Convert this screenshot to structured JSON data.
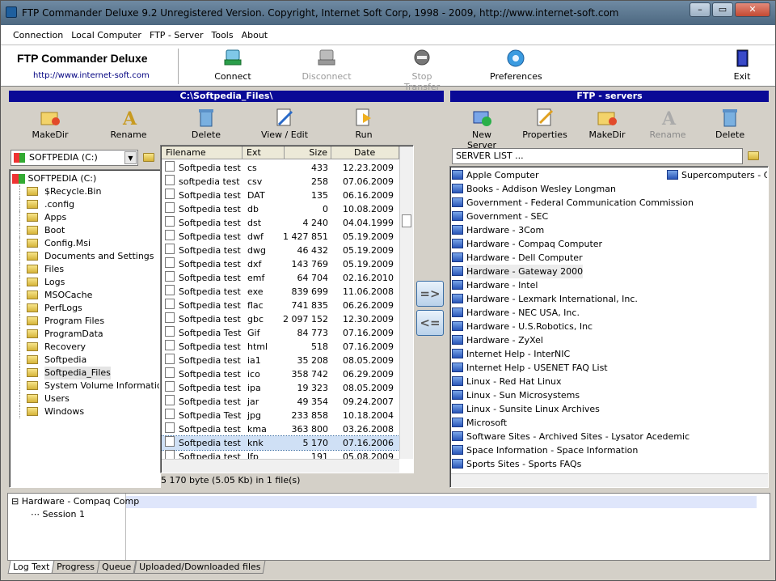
{
  "window": {
    "title": "FTP Commander Deluxe 9.2  Unregistered Version. Copyright, Internet Soft Corp, 1998 - 2009, http://www.internet-soft.com",
    "min": "–",
    "max": "▭",
    "close": "✕"
  },
  "menu": [
    "Connection",
    "Local Computer",
    "FTP - Server",
    "Tools",
    "About"
  ],
  "brand": {
    "name": "FTP Commander Deluxe",
    "url": "http://www.internet-soft.com"
  },
  "toolbar": {
    "connect": "Connect",
    "disconnect": "Disconnect",
    "stop": "Stop Transfer",
    "prefs": "Preferences",
    "exit": "Exit"
  },
  "left": {
    "path": "C:\\Softpedia_Files\\",
    "makedir": "MakeDir",
    "rename": "Rename",
    "delete": "Delete",
    "view": "View / Edit",
    "run": "Run",
    "drive": "SOFTPEDIA (C:)"
  },
  "tree": {
    "root": "SOFTPEDIA (C:)",
    "items": [
      "$Recycle.Bin",
      ".config",
      "Apps",
      "Boot",
      "Config.Msi",
      "Documents and Settings",
      "Files",
      "Logs",
      "MSOCache",
      "PerfLogs",
      "Program Files",
      "ProgramData",
      "Recovery",
      "Softpedia",
      "Softpedia_Files",
      "System Volume Information",
      "Users",
      "Windows"
    ]
  },
  "files": {
    "headers": [
      "Filename",
      "Ext",
      "Size",
      "Date"
    ],
    "rows": [
      [
        "Softpedia test",
        "cs",
        "433",
        "12.23.2009"
      ],
      [
        "softpedia test",
        "csv",
        "258",
        "07.06.2009"
      ],
      [
        "Softpedia test",
        "DAT",
        "135",
        "06.16.2009"
      ],
      [
        "Softpedia test",
        "db",
        "0",
        "10.08.2009"
      ],
      [
        "Softpedia test",
        "dst",
        "4 240",
        "04.04.1999"
      ],
      [
        "Softpedia test",
        "dwf",
        "1 427 851",
        "05.19.2009"
      ],
      [
        "Softpedia test",
        "dwg",
        "46 432",
        "05.19.2009"
      ],
      [
        "Softpedia test",
        "dxf",
        "143 769",
        "05.19.2009"
      ],
      [
        "Softpedia test",
        "emf",
        "64 704",
        "02.16.2010"
      ],
      [
        "Softpedia test",
        "exe",
        "839 699",
        "11.06.2008"
      ],
      [
        "Softpedia test",
        "flac",
        "741 835",
        "06.26.2009"
      ],
      [
        "Softpedia test",
        "gbc",
        "2 097 152",
        "12.30.2009"
      ],
      [
        "Softpedia Test",
        "Gif",
        "84 773",
        "07.16.2009"
      ],
      [
        "Softpedia test",
        "html",
        "518",
        "07.16.2009"
      ],
      [
        "Softpedia test",
        "ia1",
        "35 208",
        "08.05.2009"
      ],
      [
        "Softpedia test",
        "ico",
        "358 742",
        "06.29.2009"
      ],
      [
        "Softpedia test",
        "ipa",
        "19 323",
        "08.05.2009"
      ],
      [
        "Softpedia test",
        "jar",
        "49 354",
        "09.24.2007"
      ],
      [
        "Softpedia Test",
        "jpg",
        "233 858",
        "10.18.2004"
      ],
      [
        "Softpedia test",
        "kma",
        "363 800",
        "03.26.2008"
      ],
      [
        "Softpedia test",
        "knk",
        "5 170",
        "07.16.2006"
      ],
      [
        "Softpedia test",
        "lfp",
        "191",
        "05.08.2009"
      ]
    ]
  },
  "status": "5 170 byte (5.05 Kb) in 1 file(s)",
  "transfer": {
    "right": "=>",
    "left": "<="
  },
  "right": {
    "header": "FTP - servers",
    "new": "New Server",
    "props": "Properties",
    "makedir": "MakeDir",
    "rename": "Rename",
    "delete": "Delete",
    "combo": "SERVER LIST ..."
  },
  "servers": [
    "Apple Computer",
    "Books - Addison Wesley Longman",
    "Government - Federal Communication Commission",
    "Government - SEC",
    "Hardware - 3Com",
    "Hardware - Compaq Computer",
    "Hardware - Dell Computer",
    "Hardware - Gateway 2000",
    "Hardware - Intel",
    "Hardware - Lexmark International, Inc.",
    "Hardware - NEC USA, Inc.",
    "Hardware - U.S.Robotics, Inc",
    "Hardware - ZyXel",
    "Internet Help - InterNIC",
    "Internet Help - USENET FAQ List",
    "Linux - Red Hat Linux",
    "Linux - Sun Microsystems",
    "Linux - Sunsite Linux Archives",
    "Microsoft",
    "Software Sites - Archived Sites - Lysator Acedemic",
    "Space Information - Space Information",
    "Sports Sites - Sports FAQs"
  ],
  "servers2": [
    "Supercomputers - Cray"
  ],
  "log": {
    "node": "Hardware - Compaq Comp",
    "session": "Session 1"
  },
  "tabs": [
    "Log Text",
    "Progress",
    "Queue",
    "Uploaded/Downloaded files"
  ]
}
